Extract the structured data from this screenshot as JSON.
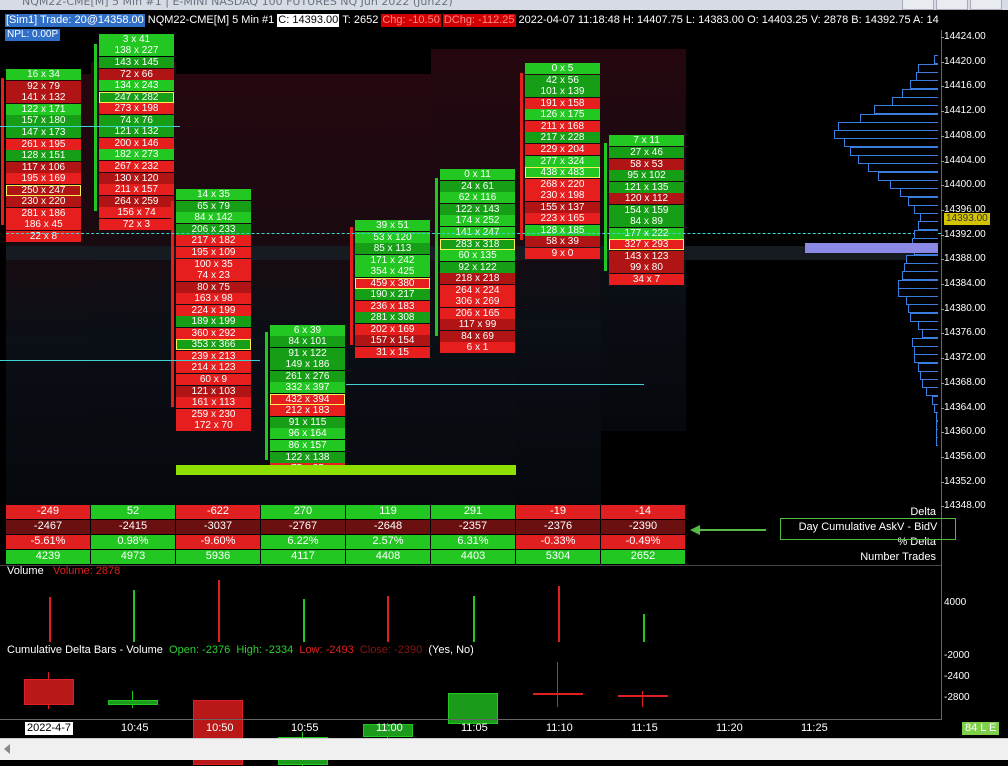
{
  "window": {
    "title": "NQM22-CME[M]  5 Min   #1 | E-MINI NASDAQ 100 FUTURES NQ Jun 2022 (Jun22)"
  },
  "header": {
    "sim": "[Sim1]  Trade: 20@14358.00",
    "symbol": "NQM22-CME[M]  5 Min  #1",
    "close": "C: 14393.00",
    "trades": "T: 2652",
    "chg": "Chg: -10.50",
    "dchg": "DChg: -112.25",
    "ohlc": "2022-04-07 11:18:48 H: 14407.75 L: 14383.00 O: 14403.25 V: 2878 B: 14392.75 A: 14",
    "npl": "NPL: 0.00P"
  },
  "price_axis": {
    "labels": [
      "14424.00",
      "14420.00",
      "14416.00",
      "14412.00",
      "14408.00",
      "14404.00",
      "14400.00",
      "14396.00",
      "14392.00",
      "14388.00",
      "14384.00",
      "14380.00",
      "14376.00",
      "14372.00",
      "14368.00",
      "14364.00",
      "14360.00",
      "14356.00",
      "14352.00",
      "14348.00"
    ],
    "current": "14393.00"
  },
  "footprint": [
    {
      "cells": [
        "16 x 34",
        "92 x 79",
        "141 x 132",
        "122 x 171",
        "157 x 180",
        "147 x 173",
        "261 x 195",
        "128 x 151",
        "117 x 106",
        "195 x 169",
        "250 x 247",
        "230 x 220",
        "281 x 186",
        "186 x 45",
        "22 x 8"
      ]
    },
    {
      "cells": [
        "3 x 41",
        "138 x 227",
        "143 x 145",
        "72 x 66",
        "134 x 243",
        "247 x 282",
        "273 x 198",
        "74 x 76",
        "121 x 132",
        "200 x 146",
        "182 x 273",
        "267 x 232",
        "130 x 120",
        "211 x 157",
        "264 x 259",
        "156 x 74",
        "72 x 3"
      ]
    },
    {
      "cells": [
        "14 x 35",
        "65 x 79",
        "84 x 142",
        "206 x 233",
        "217 x 182",
        "195 x 109",
        "100 x 35",
        "74 x 23",
        "80 x 75",
        "163 x 98",
        "224 x 199",
        "189 x 199",
        "360 x 292",
        "353 x 366",
        "239 x 213",
        "214 x 123",
        "60 x 9",
        "121 x 103",
        "161 x 113",
        "259 x 230",
        "172 x 70"
      ]
    },
    {
      "cells": [
        "6 x 39",
        "84 x 101",
        "91 x 122",
        "149 x 186",
        "261 x 276",
        "332 x 397",
        "432 x 394",
        "212 x 183",
        "91 x 115",
        "96 x 164",
        "86 x 157",
        "122 x 138",
        "75 x 35"
      ]
    },
    {
      "cells": [
        "39 x 51",
        "53 x 120",
        "85 x 113",
        "171 x 242",
        "354 x 425",
        "459 x 380",
        "190 x 217",
        "236 x 183",
        "281 x 308",
        "202 x 169",
        "157 x 154",
        "31 x 15"
      ]
    },
    {
      "cells": [
        "0 x 11",
        "24 x 61",
        "62 x 116",
        "122 x 143",
        "174 x 252",
        "141 x 247",
        "283 x 318",
        "60 x 135",
        "92 x 122",
        "218 x 218",
        "264 x 224",
        "306 x 269",
        "206 x 165",
        "117 x 99",
        "84 x 69",
        "6 x 1"
      ]
    },
    {
      "cells": [
        "0 x 5",
        "42 x 56",
        "101 x 139",
        "191 x 158",
        "126 x 175",
        "211 x 168",
        "217 x 228",
        "229 x 204",
        "277 x 324",
        "438 x 483",
        "268 x 220",
        "230 x 198",
        "155 x 137",
        "223 x 165",
        "128 x 185",
        "58 x 39",
        "9 x 0"
      ]
    },
    {
      "cells": [
        "7 x 11",
        "27 x 46",
        "58 x 53",
        "95 x 102",
        "121 x 135",
        "120 x 112",
        "154 x 159",
        "84 x 89",
        "177 x 222",
        "327 x 293",
        "143 x 123",
        "99 x 80",
        "34 x 7"
      ]
    }
  ],
  "summary": {
    "rows": [
      {
        "label": "Delta",
        "values": [
          "-249",
          "52",
          "-622",
          "270",
          "119",
          "291",
          "-19",
          "-14"
        ]
      },
      {
        "label": "Day Cumulative AskV - BidV",
        "values": [
          "-2467",
          "-2415",
          "-3037",
          "-2767",
          "-2648",
          "-2357",
          "-2376",
          "-2390"
        ]
      },
      {
        "label": "% Delta",
        "values": [
          "-5.61%",
          "0.98%",
          "-9.60%",
          "6.22%",
          "2.57%",
          "6.31%",
          "-0.33%",
          "-0.49%"
        ]
      },
      {
        "label": "Number Trades",
        "values": [
          "4239",
          "4973",
          "5936",
          "4117",
          "4408",
          "4403",
          "5304",
          "2652"
        ]
      }
    ]
  },
  "volume_panel": {
    "title": "Volume",
    "value": "Volume: 2878",
    "axis": "4000"
  },
  "cdb_panel": {
    "title": "Cumulative Delta Bars - Volume",
    "open": "Open: -2376",
    "high": "High: -2334",
    "low": "Low: -2493",
    "close": "Close: -2390",
    "flags": "(Yes, No)",
    "axis": [
      "-2000",
      "-2400",
      "-2800"
    ]
  },
  "time_axis": {
    "labels": [
      "2022-4-7",
      "10:45",
      "10:50",
      "10:55",
      "11:00",
      "11:05",
      "11:10",
      "11:15",
      "11:20",
      "11:25"
    ],
    "badge": "84 L E"
  },
  "colors": {
    "ask_green": "#22c722",
    "bid_red": "#e61e1e",
    "profile": "#3a7fe0",
    "poc": "#ffee55",
    "current": "#3fd3d3"
  }
}
